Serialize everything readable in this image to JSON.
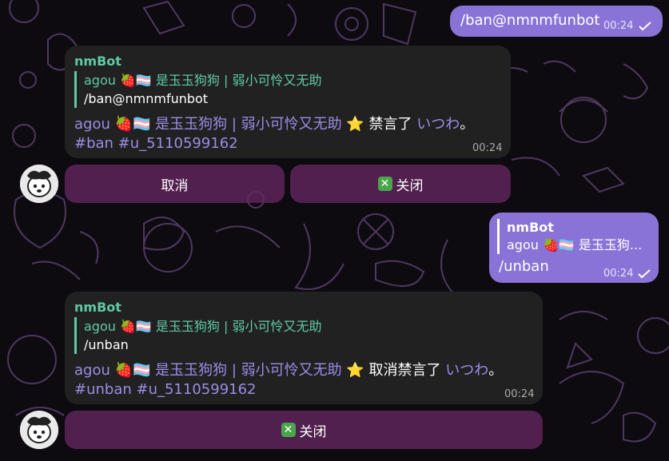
{
  "messages": [
    {
      "type": "outgoing",
      "text": "/ban@nmnmfunbot",
      "time": "00:24"
    },
    {
      "type": "incoming",
      "sender": "nmBot",
      "quote_name": "agou 🍓🏳️‍⚧️ 是玉玉狗狗 | 弱小可怜又无助",
      "quote_text": "/ban@nmnmfunbot",
      "user": "agou 🍓🏳️‍⚧️ 是玉玉狗狗 | 弱小可怜又无助",
      "star": "⭐",
      "action": "禁言了",
      "target": "いつわ",
      "end": "。",
      "tags": "#ban #u_5110599162",
      "time": "00:24",
      "buttons": [
        "取消",
        "关闭"
      ]
    },
    {
      "type": "outgoing",
      "quote_name": "nmBot",
      "quote_text": "agou 🍓🏳️‍⚧️ 是玉玉狗...",
      "text": "/unban",
      "time": "00:24"
    },
    {
      "type": "incoming",
      "sender": "nmBot",
      "quote_name": "agou 🍓🏳️‍⚧️ 是玉玉狗狗 | 弱小可怜又无助",
      "quote_text": "/unban",
      "user": "agou 🍓🏳️‍⚧️ 是玉玉狗狗 | 弱小可怜又无助",
      "star": "⭐",
      "action": "取消禁言了",
      "target": "いつわ",
      "end": "。",
      "tags": "#unban #u_5110599162",
      "time": "00:24",
      "buttons": [
        "关闭"
      ]
    }
  ],
  "icons": {
    "close_button_icon": "✕"
  },
  "colors": {
    "outgoing_bubble": "#8a73d6",
    "incoming_bubble": "#212121",
    "accent_green": "#5fc9a7",
    "mention_purple": "#9c8ce6",
    "keyboard_button": "#652661"
  }
}
